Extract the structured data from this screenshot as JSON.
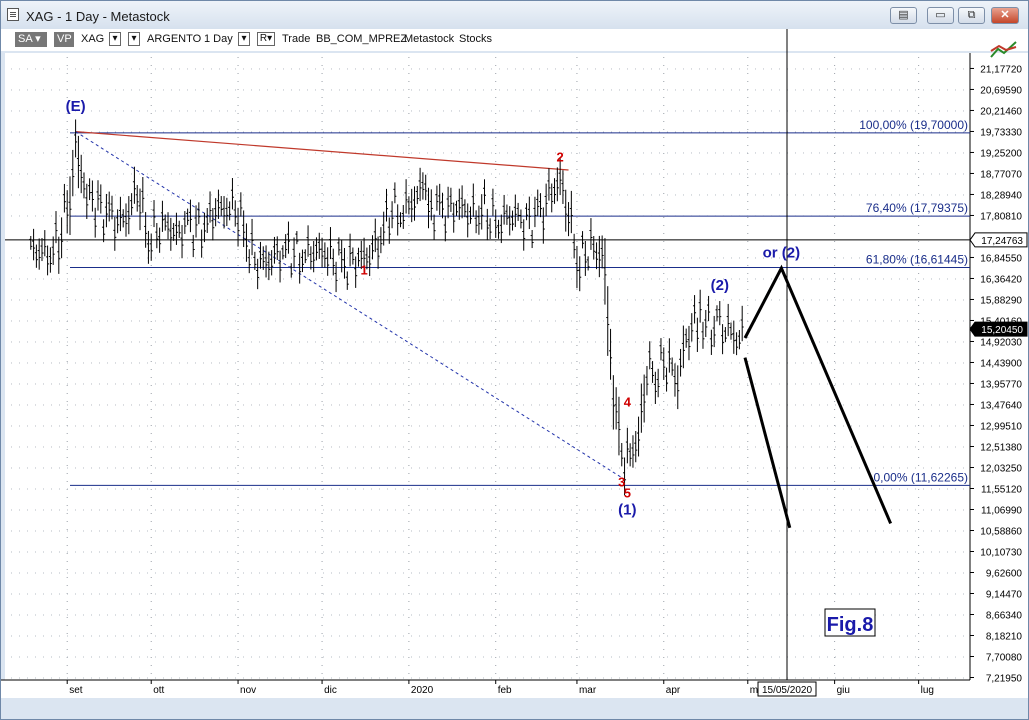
{
  "window": {
    "title": "XAG - 1 Day - Metastock",
    "minimize_glyph": "▭",
    "restore_glyph": "⧉",
    "close_glyph": "✕",
    "extra_glyph": "▤"
  },
  "toolbar": {
    "sa_label": "SA",
    "vp_label": "VP",
    "symbol": "XAG",
    "name": "ARGENTO",
    "period": "1 Day",
    "r_label": "R▾",
    "trade_label": "Trade",
    "source": "BB_COM_MPREZ",
    "platform": "Metastock",
    "type": "Stocks",
    "dropdown_glyph": "▾",
    "tools_icon": "crosshair-chart-icon"
  },
  "colors": {
    "price_bars": "#000000",
    "fib_lines": "#1a2e8a",
    "trend_line": "#c0392b",
    "dotted_line": "#2233aa",
    "label_blue": "#1a1aaa",
    "label_red": "#d00000",
    "projection": "#000000"
  },
  "chart_data": {
    "type": "ohlc",
    "instrument": "XAG",
    "y_axis_ticks": [
      "21,17720",
      "20,69590",
      "20,21460",
      "19,73330",
      "19,25200",
      "18,77070",
      "18,28940",
      "17,80810",
      "16,84550",
      "16,36420",
      "15,88290",
      "15,40160",
      "14,92030",
      "14,43900",
      "13,95770",
      "13,47640",
      "12,99510",
      "12,51380",
      "12,03250",
      "11,55120",
      "11,06990",
      "10,58860",
      "10,10730",
      "9,62600",
      "9,14470",
      "8,66340",
      "8,18210",
      "7,70080",
      "7,21950"
    ],
    "y_axis_values": [
      21.1772,
      20.6959,
      20.2146,
      19.7333,
      19.252,
      18.7707,
      18.2894,
      17.8081,
      16.8455,
      16.3642,
      15.8829,
      15.4016,
      14.9203,
      14.439,
      13.9577,
      13.4764,
      12.9951,
      12.5138,
      12.0325,
      11.5512,
      11.0699,
      10.5886,
      10.1073,
      9.626,
      9.1447,
      8.6634,
      8.1821,
      7.7008,
      7.2195
    ],
    "x_axis_labels": [
      "set",
      "ott",
      "nov",
      "dic",
      "2020",
      "feb",
      "mar",
      "apr",
      "m",
      "giu",
      "lug"
    ],
    "cursor_date": "15/05/2020",
    "cursor_price": "17,24763",
    "last_price": "15,20450",
    "y_range": [
      7.2,
      21.4
    ],
    "fib_levels": [
      {
        "label": "100,00% (19,70000)",
        "value": 19.7
      },
      {
        "label": "76,40% (17,79375)",
        "value": 17.79375
      },
      {
        "label": "61,80% (16,61445)",
        "value": 16.61445
      },
      {
        "label": "0,00% (11,62265)",
        "value": 11.62265
      }
    ],
    "cursor_line_value": 17.24763,
    "wave_labels": [
      {
        "text": "(E)",
        "color": "blue",
        "date": "2019-09-04",
        "price": 20.2
      },
      {
        "text": "1",
        "color": "red",
        "date": "2019-12-16",
        "price": 16.45
      },
      {
        "text": "2",
        "color": "red",
        "date": "2020-02-24",
        "price": 19.05
      },
      {
        "text": "3",
        "color": "red",
        "date": "2020-03-17",
        "price": 11.6
      },
      {
        "text": "4",
        "color": "red",
        "date": "2020-03-19",
        "price": 13.43
      },
      {
        "text": "5",
        "color": "red",
        "date": "2020-03-19",
        "price": 11.35
      },
      {
        "text": "(1)",
        "color": "blue",
        "date": "2020-03-19",
        "price": 10.95
      },
      {
        "text": "(2)",
        "color": "blue",
        "date": "2020-04-21",
        "price": 16.1
      },
      {
        "text": "or (2)",
        "color": "blue",
        "date": "2020-05-13",
        "price": 16.84
      }
    ],
    "price_series": [
      {
        "date": "2019-08-19",
        "close": 17.0
      },
      {
        "date": "2019-08-22",
        "close": 16.95
      },
      {
        "date": "2019-08-26",
        "close": 17.0
      },
      {
        "date": "2019-08-29",
        "close": 17.2
      },
      {
        "date": "2019-09-02",
        "close": 18.3
      },
      {
        "date": "2019-09-04",
        "close": 19.7
      },
      {
        "date": "2019-09-06",
        "close": 18.7
      },
      {
        "date": "2019-09-09",
        "close": 18.2
      },
      {
        "date": "2019-09-12",
        "close": 18.0
      },
      {
        "date": "2019-09-16",
        "close": 17.8
      },
      {
        "date": "2019-09-19",
        "close": 17.6
      },
      {
        "date": "2019-09-23",
        "close": 17.9
      },
      {
        "date": "2019-09-26",
        "close": 18.4
      },
      {
        "date": "2019-09-30",
        "close": 17.3
      },
      {
        "date": "2019-10-03",
        "close": 17.5
      },
      {
        "date": "2019-10-07",
        "close": 17.6
      },
      {
        "date": "2019-10-10",
        "close": 17.4
      },
      {
        "date": "2019-10-14",
        "close": 17.6
      },
      {
        "date": "2019-10-17",
        "close": 17.5
      },
      {
        "date": "2019-10-21",
        "close": 17.6
      },
      {
        "date": "2019-10-24",
        "close": 17.9
      },
      {
        "date": "2019-10-28",
        "close": 18.0
      },
      {
        "date": "2019-10-31",
        "close": 18.0
      },
      {
        "date": "2019-11-04",
        "close": 17.3
      },
      {
        "date": "2019-11-07",
        "close": 16.8
      },
      {
        "date": "2019-11-11",
        "close": 16.7
      },
      {
        "date": "2019-11-14",
        "close": 16.9
      },
      {
        "date": "2019-11-18",
        "close": 17.0
      },
      {
        "date": "2019-11-21",
        "close": 16.9
      },
      {
        "date": "2019-11-25",
        "close": 16.9
      },
      {
        "date": "2019-11-28",
        "close": 16.95
      },
      {
        "date": "2019-12-02",
        "close": 17.0
      },
      {
        "date": "2019-12-05",
        "close": 16.8
      },
      {
        "date": "2019-12-09",
        "close": 16.7
      },
      {
        "date": "2019-12-12",
        "close": 16.8
      },
      {
        "date": "2019-12-16",
        "close": 16.8
      },
      {
        "date": "2019-12-19",
        "close": 17.0
      },
      {
        "date": "2019-12-23",
        "close": 17.5
      },
      {
        "date": "2019-12-26",
        "close": 17.9
      },
      {
        "date": "2019-12-30",
        "close": 17.9
      },
      {
        "date": "2020-01-03",
        "close": 18.2
      },
      {
        "date": "2020-01-07",
        "close": 18.5
      },
      {
        "date": "2020-01-09",
        "close": 18.0
      },
      {
        "date": "2020-01-13",
        "close": 17.9
      },
      {
        "date": "2020-01-16",
        "close": 18.0
      },
      {
        "date": "2020-01-20",
        "close": 18.0
      },
      {
        "date": "2020-01-23",
        "close": 17.8
      },
      {
        "date": "2020-01-27",
        "close": 18.0
      },
      {
        "date": "2020-01-30",
        "close": 17.7
      },
      {
        "date": "2020-02-03",
        "close": 17.7
      },
      {
        "date": "2020-02-06",
        "close": 17.8
      },
      {
        "date": "2020-02-10",
        "close": 17.7
      },
      {
        "date": "2020-02-13",
        "close": 17.7
      },
      {
        "date": "2020-02-17",
        "close": 17.8
      },
      {
        "date": "2020-02-20",
        "close": 18.3
      },
      {
        "date": "2020-02-24",
        "close": 18.6
      },
      {
        "date": "2020-02-27",
        "close": 17.8
      },
      {
        "date": "2020-03-02",
        "close": 16.7
      },
      {
        "date": "2020-03-05",
        "close": 17.0
      },
      {
        "date": "2020-03-09",
        "close": 17.1
      },
      {
        "date": "2020-03-11",
        "close": 16.6
      },
      {
        "date": "2020-03-13",
        "close": 14.5
      },
      {
        "date": "2020-03-16",
        "close": 12.7
      },
      {
        "date": "2020-03-17",
        "close": 12.0
      },
      {
        "date": "2020-03-19",
        "close": 12.3
      },
      {
        "date": "2020-03-23",
        "close": 12.7
      },
      {
        "date": "2020-03-26",
        "close": 14.2
      },
      {
        "date": "2020-03-30",
        "close": 14.3
      },
      {
        "date": "2020-04-02",
        "close": 14.4
      },
      {
        "date": "2020-04-06",
        "close": 14.1
      },
      {
        "date": "2020-04-09",
        "close": 15.0
      },
      {
        "date": "2020-04-14",
        "close": 15.5
      },
      {
        "date": "2020-04-17",
        "close": 15.3
      },
      {
        "date": "2020-04-21",
        "close": 15.2
      },
      {
        "date": "2020-04-24",
        "close": 15.2
      },
      {
        "date": "2020-04-28",
        "close": 15.0
      },
      {
        "date": "2020-04-30",
        "close": 15.2
      }
    ],
    "annotation": "Fig.8"
  }
}
